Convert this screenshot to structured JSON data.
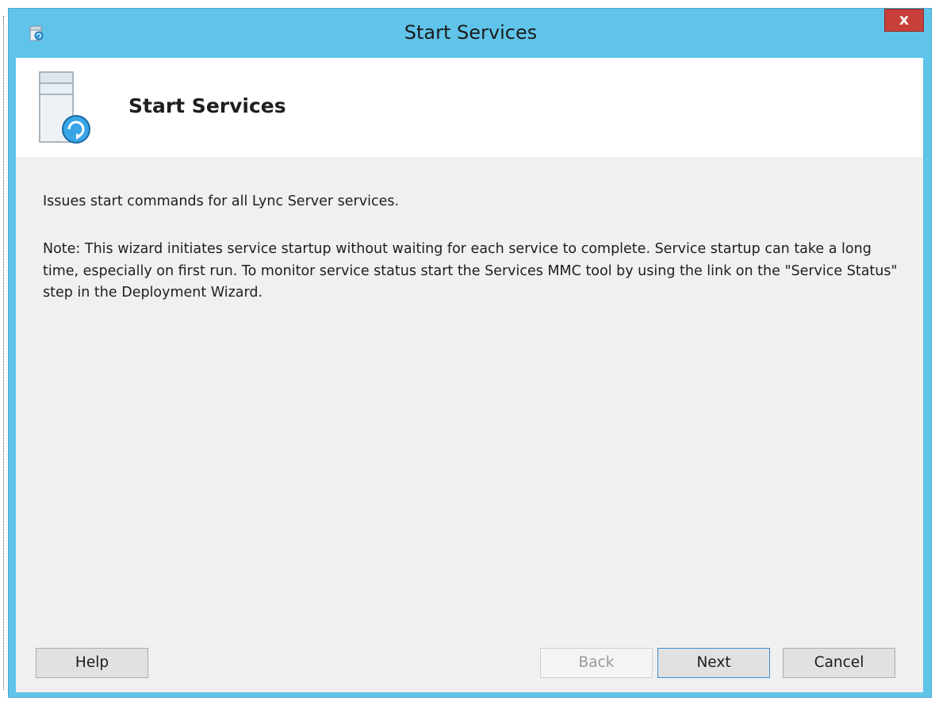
{
  "window": {
    "title": "Start Services",
    "close_label": "x"
  },
  "header": {
    "title": "Start Services"
  },
  "content": {
    "description": "Issues start commands for all Lync Server services.",
    "note": "Note: This wizard initiates service startup without waiting for each service to complete. Service startup can take a long time, especially on first run. To monitor service status start the Services MMC tool by using the link on the \"Service Status\" step in the Deployment Wizard."
  },
  "buttons": {
    "help": "Help",
    "back": "Back",
    "next": "Next",
    "cancel": "Cancel"
  },
  "icons": {
    "title_icon": "services-app-icon",
    "header_icon": "server-refresh-icon"
  },
  "colors": {
    "window_frame": "#60c4ea",
    "close_button": "#c7403a",
    "client_background": "#f0f0f0",
    "header_background": "#ffffff",
    "next_button_border": "#3c8ed4"
  }
}
